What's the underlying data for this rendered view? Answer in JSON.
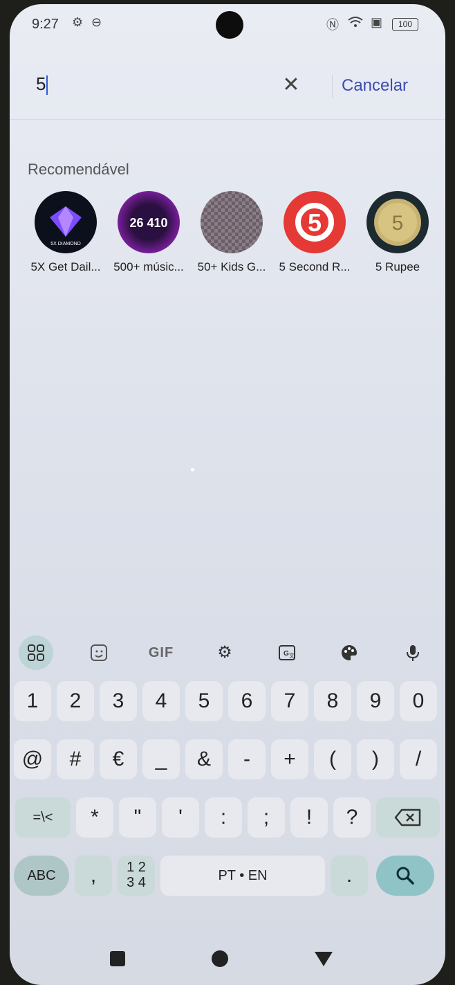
{
  "status_bar": {
    "time": "9:27",
    "battery": "100"
  },
  "search": {
    "value": "5",
    "clear_icon": "close-icon",
    "cancel_label": "Cancelar"
  },
  "recommended": {
    "title": "Recomendável",
    "apps": [
      {
        "label": "5X Get Dail...",
        "color": "#0c0f1c",
        "icon_text": "5X DIAMOND"
      },
      {
        "label": "500+ músic...",
        "color": "#3a1a5a",
        "icon_text": "26 410"
      },
      {
        "label": "50+ Kids G...",
        "color": "#7a6d78",
        "icon_text": ""
      },
      {
        "label": "5 Second R...",
        "color": "#e53935",
        "icon_text": "5"
      },
      {
        "label": "5 Rupee",
        "color": "#1d2a30",
        "icon_text": "5"
      }
    ]
  },
  "keyboard_toolbar": {
    "gif_label": "GIF"
  },
  "keyboard": {
    "row1": [
      "1",
      "2",
      "3",
      "4",
      "5",
      "6",
      "7",
      "8",
      "9",
      "0"
    ],
    "row2": [
      "@",
      "#",
      "€",
      "_",
      "&",
      "-",
      "+",
      "(",
      ")",
      "/"
    ],
    "row3": [
      "=\\<",
      "*",
      "\"",
      "'",
      ":",
      ";",
      "!",
      "?"
    ],
    "abc_label": "ABC",
    "comma_label": ",",
    "numpad_label_top": "1 2",
    "numpad_label_bottom": "3 4",
    "space_label": "PT • EN",
    "period_label": "."
  },
  "colors": {
    "accent": "#3b4db0",
    "keyboard_function": "#c9dad8",
    "search_key": "#8fc3c6"
  }
}
